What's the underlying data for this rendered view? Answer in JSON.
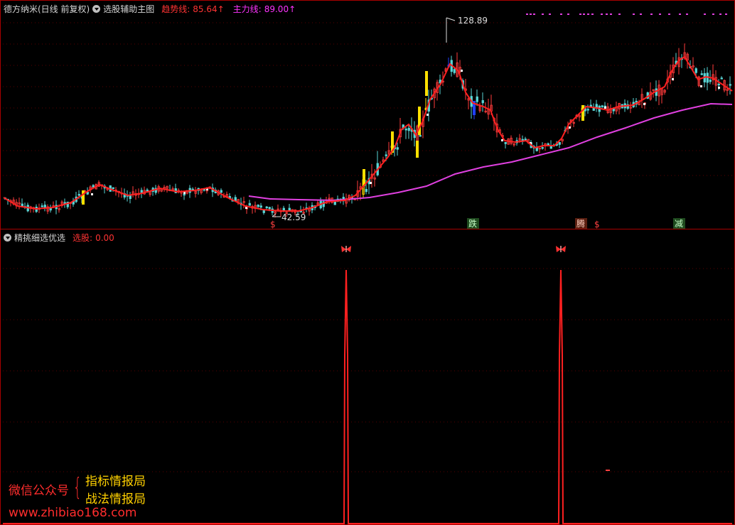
{
  "top_header": {
    "stock": "德方纳米(日线 前复权)",
    "indicator": "选股辅助主图",
    "trend_label": "趋势线:",
    "trend_value": "85.64↑",
    "main_label": "主力线:",
    "main_value": "89.00↑"
  },
  "bottom_header": {
    "indicator": "精挑细选优选",
    "select_label": "选股:",
    "select_value": "0.00"
  },
  "price_labels": {
    "high": "128.89",
    "low": "42.59"
  },
  "signals": {
    "fall": "跌",
    "rise": "腾",
    "reduce": "减",
    "buy": "$"
  },
  "watermark": {
    "left": "微信公众号",
    "brace": "{",
    "line1": "指标情报局",
    "line2": "战法情报局",
    "url": "www.zhibiao168.com"
  },
  "colors": {
    "up": "#ff3b3b",
    "down": "#5ad6d6",
    "trend": "#ff2020",
    "main": "#e040e0",
    "yellow_bar": "#ffe000",
    "blue_bar": "#2040ff",
    "frame": "#a80000"
  },
  "chart_data": {
    "type": "line",
    "price_high": 128.89,
    "price_low": 42.59,
    "trend_last": 85.64,
    "main_last": 89.0,
    "selection_last": 0.0
  }
}
